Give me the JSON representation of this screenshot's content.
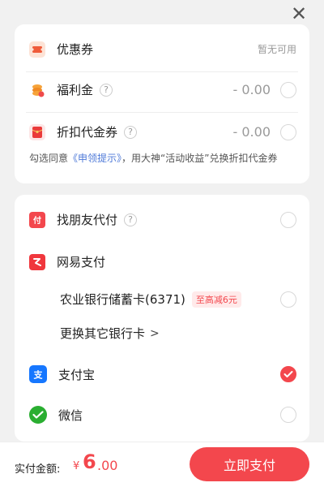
{
  "header": {
    "close_label": "✕"
  },
  "discounts": {
    "coupon": {
      "label": "优惠券",
      "status": "暂无可用"
    },
    "welfare": {
      "label": "福利金",
      "amount": "- 0.00"
    },
    "voucher": {
      "label": "折扣代金券",
      "amount": "- 0.00"
    },
    "note": {
      "prefix": "勾选同意",
      "link": "《申领提示》",
      "suffix": "，用大神“活动收益”兑换折扣代金券"
    }
  },
  "payment_methods": {
    "friend_pay": {
      "label": "找朋友代付"
    },
    "netease_pay": {
      "label": "网易支付"
    },
    "bank_card": {
      "label": "农业银行储蓄卡(6371)",
      "tag": "至高减6元"
    },
    "change_card": {
      "label": "更换其它银行卡"
    },
    "alipay": {
      "label": "支付宝"
    },
    "wechat": {
      "label": "微信"
    }
  },
  "footer": {
    "amount_label": "实付金额:",
    "currency": "¥",
    "amount_int": "6",
    "amount_dec": ".00",
    "pay_button": "立即支付"
  },
  "colors": {
    "accent": "#f3474d",
    "link": "#4f7ad8",
    "alipay": "#1677ff",
    "wechat": "#2aae31",
    "coupon": "#ef5b3a"
  },
  "icons": {
    "coupon": "ticket-icon",
    "welfare": "coin-icon",
    "voucher": "red-envelope-icon",
    "friend_pay": "friend-pay-icon",
    "netease_pay": "netease-pay-icon",
    "alipay": "alipay-icon",
    "wechat": "wechat-pay-icon"
  }
}
